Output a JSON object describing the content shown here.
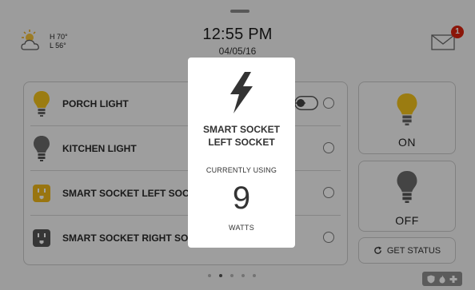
{
  "status_bar": {
    "weather": {
      "icon": "partly-cloudy-icon",
      "high": "H 70°",
      "low": "L 56°"
    },
    "time": "12:55 PM",
    "date": "04/05/16",
    "mail": {
      "icon": "envelope-icon",
      "badge_count": "1"
    }
  },
  "devices": [
    {
      "label": "PORCH LIGHT",
      "icon": "bulb-on-icon",
      "control": "toggle"
    },
    {
      "label": "KITCHEN LIGHT",
      "icon": "bulb-off-icon",
      "control": "radio"
    },
    {
      "label": "SMART SOCKET LEFT SOC",
      "icon": "socket-on-icon",
      "control": "radio"
    },
    {
      "label": "SMART SOCKET RIGHT SO",
      "icon": "socket-off-icon",
      "control": "radio"
    }
  ],
  "actions": {
    "on_label": "ON",
    "off_label": "OFF",
    "status_label": "GET STATUS",
    "status_icon": "refresh-icon"
  },
  "pagination": {
    "pages": 5,
    "active_index": 1
  },
  "modal": {
    "icon": "lightning-icon",
    "title_line1": "SMART SOCKET",
    "title_line2": "LEFT SOCKET",
    "caption": "CURRENTLY USING",
    "value": "9",
    "unit": "WATTS"
  },
  "system_icons": [
    "shield-icon",
    "flame-icon",
    "medical-cross-icon"
  ],
  "colors": {
    "bulb_on": "#f2c21b",
    "bulb_off": "#6b6b6b",
    "socket_on": "#efb81a",
    "badge": "#d9230f",
    "overlay": "rgba(0,0,0,0.36)"
  }
}
